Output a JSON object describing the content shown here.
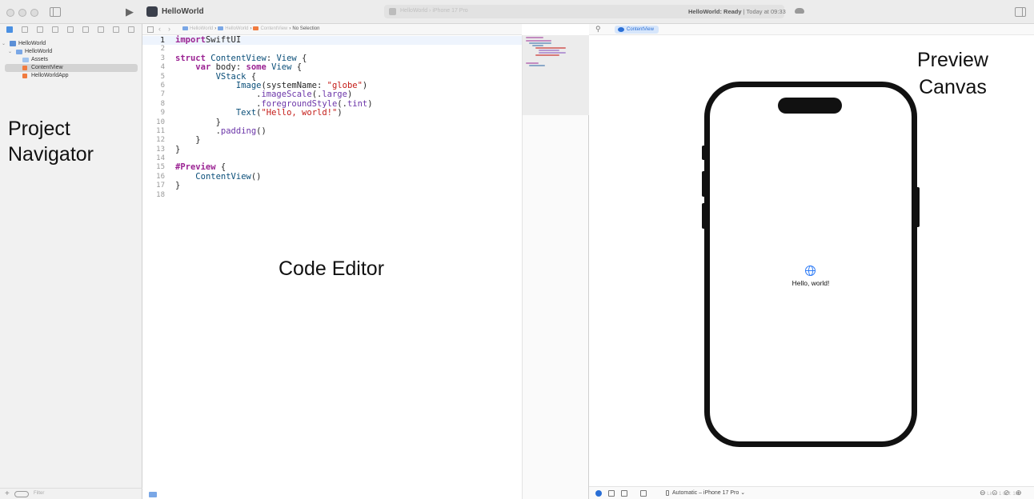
{
  "window": {
    "project_name": "HelloWorld",
    "scheme": "HelloWorld  ›  iPhone 17 Pro",
    "status_prefix": "HelloWorld: Ready",
    "status_suffix": "| Today at 09:33"
  },
  "navigator": {
    "tree": [
      {
        "label": "HelloWorld",
        "level": 0,
        "kind": "project",
        "expanded": true
      },
      {
        "label": "HelloWorld",
        "level": 1,
        "kind": "folder",
        "expanded": true
      },
      {
        "label": "Assets",
        "level": 2,
        "kind": "assets"
      },
      {
        "label": "ContentView",
        "level": 2,
        "kind": "swift",
        "selected": true
      },
      {
        "label": "HelloWorldApp",
        "level": 2,
        "kind": "swift"
      }
    ],
    "annotation_line1": "Project",
    "annotation_line2": "Navigator",
    "filter_placeholder": "Filter"
  },
  "editor": {
    "jumpbar": {
      "items": [
        "HelloWorld",
        "HelloWorld",
        "ContentView",
        "No Selection"
      ]
    },
    "current_line": 1,
    "lines": [
      [
        [
          "kw",
          "import"
        ],
        [
          "",
          "SwiftUI"
        ]
      ],
      [],
      [
        [
          "kw",
          "struct"
        ],
        [
          "",
          " "
        ],
        [
          "ty",
          "ContentView"
        ],
        [
          "",
          ": "
        ],
        [
          "ty",
          "View"
        ],
        [
          "",
          " {"
        ]
      ],
      [
        [
          "",
          "    "
        ],
        [
          "kw",
          "var"
        ],
        [
          "",
          " body: "
        ],
        [
          "kw",
          "some"
        ],
        [
          "",
          " "
        ],
        [
          "ty",
          "View"
        ],
        [
          "",
          " {"
        ]
      ],
      [
        [
          "",
          "        "
        ],
        [
          "ty",
          "VStack"
        ],
        [
          "",
          " {"
        ]
      ],
      [
        [
          "",
          "            "
        ],
        [
          "ty",
          "Image"
        ],
        [
          "",
          "(systemName: "
        ],
        [
          "str",
          "\"globe\""
        ],
        [
          "",
          ")"
        ]
      ],
      [
        [
          "",
          "                ."
        ],
        [
          "fn",
          "imageScale"
        ],
        [
          "",
          "(."
        ],
        [
          "fn",
          "large"
        ],
        [
          "",
          ")"
        ]
      ],
      [
        [
          "",
          "                ."
        ],
        [
          "fn",
          "foregroundStyle"
        ],
        [
          "",
          "(."
        ],
        [
          "fn",
          "tint"
        ],
        [
          "",
          ")"
        ]
      ],
      [
        [
          "",
          "            "
        ],
        [
          "ty",
          "Text"
        ],
        [
          "",
          "("
        ],
        [
          "str",
          "\"Hello, world!\""
        ],
        [
          "",
          ")"
        ]
      ],
      [
        [
          "",
          "        }"
        ]
      ],
      [
        [
          "",
          "        ."
        ],
        [
          "fn",
          "padding"
        ],
        [
          "",
          "()"
        ]
      ],
      [
        [
          "",
          "    }"
        ]
      ],
      [
        [
          "",
          "}"
        ]
      ],
      [],
      [
        [
          "kw",
          "#Preview"
        ],
        [
          "",
          " {"
        ]
      ],
      [
        [
          "",
          "    "
        ],
        [
          "ty",
          "ContentView"
        ],
        [
          "",
          "()"
        ]
      ],
      [
        [
          "",
          "}"
        ]
      ],
      []
    ],
    "annotation": "Code Editor"
  },
  "preview": {
    "tab_label": "ContentView",
    "annotation_line1": "Preview",
    "annotation_line2": "Canvas",
    "screen_text": "Hello, world!",
    "device_label": "Automatic – iPhone 17 Pro ⌄"
  },
  "statusbar": {
    "position": "Line: 1  Col: 16"
  },
  "colors": {
    "accent": "#2a6fd6",
    "keyword": "#9b2393",
    "type": "#0b4f79",
    "string": "#c41a16",
    "function": "#6c36a9"
  }
}
